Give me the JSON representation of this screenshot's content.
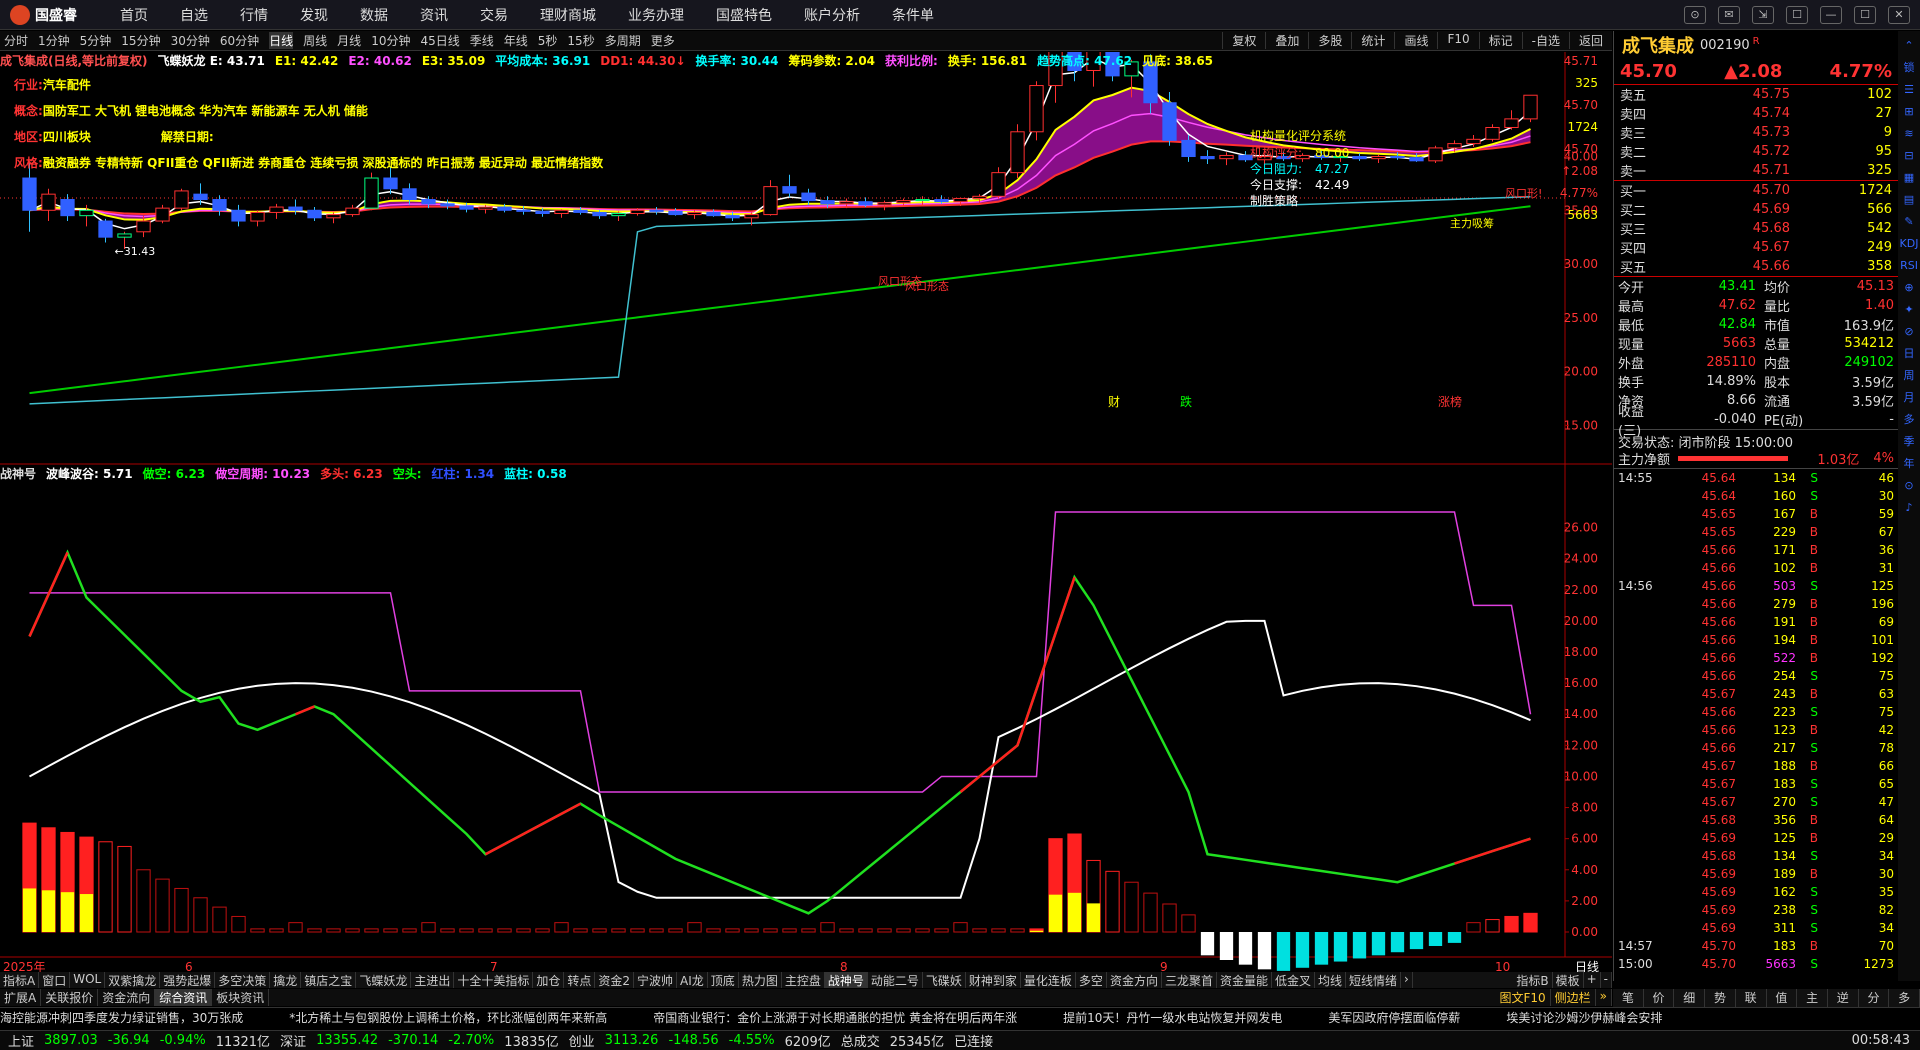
{
  "app": {
    "logo": "国盛睿",
    "menu": [
      "首页",
      "自选",
      "行情",
      "发现",
      "数据",
      "资讯",
      "交易",
      "理财商城",
      "业务办理",
      "国盛特色",
      "账户分析",
      "条件单"
    ]
  },
  "window_controls": [
    "⊙",
    "✉",
    "⇲",
    "☐",
    "—",
    "☐",
    "✕"
  ],
  "toolbar": {
    "periods": [
      "分时",
      "1分钟",
      "5分钟",
      "15分钟",
      "30分钟",
      "60分钟",
      "日线",
      "周线",
      "月线",
      "10分钟",
      "45日线",
      "季线",
      "年线",
      "5秒",
      "15秒",
      "多周期",
      "更多"
    ],
    "active": "日线",
    "right": [
      "复权",
      "叠加",
      "多股",
      "统计",
      "画线",
      "F10",
      "标记",
      "-自选",
      "返回"
    ]
  },
  "main_info": [
    {
      "t": "成飞集成(日线,等比前复权)",
      "c": "#ff5050"
    },
    {
      "t": "飞蝶妖龙 E: 43.71",
      "c": "#ffffff"
    },
    {
      "t": "E1: 42.42",
      "c": "#ffff00"
    },
    {
      "t": "E2: 40.62",
      "c": "#ff50ff"
    },
    {
      "t": "E3: 35.09",
      "c": "#ffff00"
    },
    {
      "t": "平均成本: 36.91",
      "c": "#00ffff"
    },
    {
      "t": "DD1: 44.30↓",
      "c": "#ff3030"
    },
    {
      "t": "换手率: 30.44",
      "c": "#00ffff"
    },
    {
      "t": "筹码参数: 2.04",
      "c": "#ffff00"
    },
    {
      "t": "获利比例:",
      "c": "#ff50ff"
    },
    {
      "t": "换手: 156.81",
      "c": "#ffff00"
    },
    {
      "t": "趋势高点: 47.62",
      "c": "#00ffff"
    },
    {
      "t": "见底: 38.65",
      "c": "#ffff00"
    }
  ],
  "annotations": [
    {
      "k": "行业:",
      "v": "汽车配件"
    },
    {
      "k": "概念:",
      "v": "国防军工 大飞机 锂电池概念 华为汽车 新能源车 无人机 储能"
    },
    {
      "k": "地区:",
      "v": "四川板块",
      "k2": "解禁日期:"
    },
    {
      "k": "风格:",
      "v": "融资融券 专精特新 QFII重仓 QFII新进 券商重仓 连续亏损 深股通标的 昨日振荡 最近异动 最近情绪指数"
    }
  ],
  "rating": {
    "title": "机构量化评分系统",
    "score_label": "机构评分:",
    "score": "80.00",
    "res_label": "今日阻力:",
    "res": "47.27",
    "sup_label": "今日支撑:",
    "sup": "42.49",
    "tag": "制胜策略"
  },
  "chart_labels": {
    "high": "58.77",
    "low": "←31.43",
    "f": "财",
    "d": "跌",
    "z": "涨榜",
    "wind1": "风口形态",
    "wind2": "风口形态",
    "wind3": "风口形!",
    "main_force": "主力吸筹"
  },
  "price_axis": {
    "top": [
      "45.71",
      "325",
      "45.70",
      "1724",
      "45.70",
      "↑2.08",
      "4.77%",
      "5663"
    ],
    "ticks": [
      "40.00",
      "35.00",
      "30.00",
      "25.00",
      "20.00",
      "15.00"
    ]
  },
  "sub_axis": [
    "26.00",
    "24.00",
    "22.00",
    "20.00",
    "18.00",
    "16.00",
    "14.00",
    "12.00",
    "10.00",
    "8.00",
    "6.00",
    "4.00",
    "2.00",
    "0.00"
  ],
  "x_axis": {
    "labels": [
      "2025年",
      "6",
      "7",
      "8",
      "9",
      "10"
    ],
    "right": "日线"
  },
  "sub_info": [
    {
      "t": "战神号",
      "c": "#dddddd"
    },
    {
      "t": "波峰波谷: 5.71",
      "c": "#ffffff"
    },
    {
      "t": "做空: 6.23",
      "c": "#00ff00"
    },
    {
      "t": "做空周期: 10.23",
      "c": "#ff50ff"
    },
    {
      "t": "多头: 6.23",
      "c": "#ff3030"
    },
    {
      "t": "空头:",
      "c": "#00ff00"
    },
    {
      "t": "红柱: 1.34",
      "c": "#3050ff"
    },
    {
      "t": "蓝柱: 0.58",
      "c": "#00ffff"
    }
  ],
  "chart_data": {
    "type": "candlestick",
    "x_labels": [
      "2025年",
      "6",
      "7",
      "8",
      "9",
      "10"
    ],
    "price_range": [
      14,
      46
    ],
    "series": [
      {
        "name": "E",
        "color": "#ffffff"
      },
      {
        "name": "E1",
        "color": "#ffff00"
      },
      {
        "name": "E2",
        "color": "#ff50ff"
      },
      {
        "name": "E3",
        "color": "#ffff00"
      }
    ],
    "candles": [
      [
        38,
        39.5,
        33,
        35
      ],
      [
        35,
        37,
        34,
        36.5
      ],
      [
        36,
        36.5,
        34,
        34.5
      ],
      [
        34.5,
        35.5,
        33.5,
        35
      ],
      [
        34,
        34.2,
        32,
        32.5
      ],
      [
        32.5,
        33,
        31.4,
        32.8
      ],
      [
        33,
        34.5,
        32.5,
        34
      ],
      [
        34,
        35.5,
        33.8,
        35.2
      ],
      [
        35.2,
        37,
        35,
        36.8
      ],
      [
        36.5,
        37.5,
        35.5,
        36
      ],
      [
        36,
        36.4,
        34.5,
        35
      ],
      [
        35,
        35.5,
        33.5,
        34
      ],
      [
        34,
        35,
        33.5,
        34.8
      ],
      [
        34.8,
        35.6,
        34.2,
        35.3
      ],
      [
        35.3,
        36,
        34.6,
        35
      ],
      [
        35,
        35.3,
        34,
        34.3
      ],
      [
        34.3,
        34.8,
        33.8,
        34.6
      ],
      [
        34.6,
        35.5,
        34.4,
        35.2
      ],
      [
        35.2,
        38.5,
        35,
        38
      ],
      [
        38,
        39,
        36.5,
        37
      ],
      [
        37,
        37.5,
        35.5,
        36
      ],
      [
        36,
        36.3,
        35.2,
        35.6
      ],
      [
        35.6,
        36,
        35.1,
        35.4
      ],
      [
        35.4,
        35.7,
        34.8,
        35.1
      ],
      [
        35.1,
        35.5,
        34.7,
        35.3
      ],
      [
        35.3,
        35.6,
        34.8,
        35
      ],
      [
        35,
        35.4,
        34.6,
        34.9
      ],
      [
        34.9,
        35.2,
        34.4,
        34.7
      ],
      [
        34.7,
        35.1,
        34.3,
        35
      ],
      [
        35,
        35.3,
        34.6,
        34.8
      ],
      [
        34.8,
        35,
        34.2,
        34.5
      ],
      [
        34.5,
        34.9,
        34,
        34.7
      ],
      [
        34.7,
        35.2,
        34.5,
        35
      ],
      [
        35,
        35.3,
        34.6,
        34.9
      ],
      [
        34.9,
        35.2,
        34.5,
        34.6
      ],
      [
        34.6,
        35,
        34.2,
        34.8
      ],
      [
        34.8,
        35.1,
        34.4,
        34.5
      ],
      [
        34.5,
        34.9,
        34,
        34.3
      ],
      [
        34.3,
        34.8,
        33.6,
        34.6
      ],
      [
        34.6,
        37.8,
        34.5,
        37.2
      ],
      [
        37.2,
        38.3,
        36.2,
        36.6
      ],
      [
        36.6,
        37,
        35.5,
        35.9
      ],
      [
        35.9,
        36.3,
        35.2,
        35.6
      ],
      [
        35.6,
        36.1,
        35.2,
        35.8
      ],
      [
        35.8,
        36.2,
        35.3,
        35.5
      ],
      [
        35.5,
        35.9,
        35,
        35.7
      ],
      [
        35.7,
        36.1,
        35.3,
        35.9
      ],
      [
        35.9,
        36.3,
        35.5,
        36
      ],
      [
        36,
        36.4,
        35.6,
        35.8
      ],
      [
        35.8,
        36.2,
        35.4,
        36.1
      ],
      [
        36.1,
        36.5,
        35.7,
        36.3
      ],
      [
        36.3,
        39,
        36.1,
        38.5
      ],
      [
        38.5,
        43,
        38,
        42.3
      ],
      [
        42.3,
        47,
        41.5,
        46.6
      ],
      [
        46.6,
        58.8,
        45,
        52
      ],
      [
        52,
        53,
        47,
        48
      ],
      [
        48,
        51,
        46.5,
        50.5
      ],
      [
        50.5,
        51,
        47,
        47.5
      ],
      [
        47.5,
        49,
        45.5,
        48.8
      ],
      [
        48.8,
        49.5,
        44,
        45
      ],
      [
        45,
        46,
        41,
        41.5
      ],
      [
        41.5,
        42,
        39.5,
        40
      ],
      [
        40,
        40.6,
        39.3,
        39.8
      ],
      [
        39.8,
        40.4,
        39.2,
        40.1
      ],
      [
        40.1,
        40.5,
        39.5,
        39.7
      ],
      [
        39.7,
        40.2,
        39.3,
        40
      ],
      [
        40,
        40.4,
        39.6,
        39.8
      ],
      [
        39.8,
        40.3,
        39.5,
        40.1
      ],
      [
        40.1,
        40.5,
        39.7,
        39.9
      ],
      [
        39.9,
        40.2,
        39.5,
        40
      ],
      [
        40,
        40.3,
        39.6,
        39.8
      ],
      [
        39.8,
        40.2,
        39.4,
        40
      ],
      [
        40,
        40.4,
        39.7,
        39.9
      ],
      [
        39.9,
        40.3,
        39.5,
        39.6
      ],
      [
        39.6,
        41,
        39.4,
        40.8
      ],
      [
        40.8,
        41.5,
        40.4,
        41.2
      ],
      [
        41.2,
        42,
        40.9,
        41.6
      ],
      [
        41.6,
        43,
        41.4,
        42.7
      ],
      [
        42.7,
        44.3,
        42.5,
        43.5
      ],
      [
        43.5,
        45.7,
        43.2,
        45.7
      ]
    ]
  },
  "stock": {
    "name": "成飞集成",
    "code": "002190",
    "r": "R",
    "price": "45.70",
    "change": "▲2.08",
    "pct": "4.77%"
  },
  "order_book": {
    "asks": [
      {
        "l": "卖五",
        "p": "45.75",
        "q": "102"
      },
      {
        "l": "卖四",
        "p": "45.74",
        "q": "27"
      },
      {
        "l": "卖三",
        "p": "45.73",
        "q": "9"
      },
      {
        "l": "卖二",
        "p": "45.72",
        "q": "95"
      },
      {
        "l": "卖一",
        "p": "45.71",
        "q": "325"
      }
    ],
    "bids": [
      {
        "l": "买一",
        "p": "45.70",
        "q": "1724"
      },
      {
        "l": "买二",
        "p": "45.69",
        "q": "566"
      },
      {
        "l": "买三",
        "p": "45.68",
        "q": "542"
      },
      {
        "l": "买四",
        "p": "45.67",
        "q": "249"
      },
      {
        "l": "买五",
        "p": "45.66",
        "q": "358"
      }
    ]
  },
  "stats": [
    {
      "a": "今开",
      "b": "43.41",
      "bc": "#00ff00",
      "c": "均价",
      "d": "45.13",
      "dc": "#ff3030"
    },
    {
      "a": "最高",
      "b": "47.62",
      "bc": "#ff3030",
      "c": "量比",
      "d": "1.40",
      "dc": "#ff3030"
    },
    {
      "a": "最低",
      "b": "42.84",
      "bc": "#00ff00",
      "c": "市值",
      "d": "163.9亿",
      "dc": "#dddddd"
    },
    {
      "a": "现量",
      "b": "5663",
      "bc": "#ff3030",
      "c": "总量",
      "d": "534212",
      "dc": "#ffff00"
    },
    {
      "a": "外盘",
      "b": "285110",
      "bc": "#ff3030",
      "c": "内盘",
      "d": "249102",
      "dc": "#00ff00"
    },
    {
      "a": "换手",
      "b": "14.89%",
      "bc": "#dddddd",
      "c": "股本",
      "d": "3.59亿",
      "dc": "#dddddd"
    },
    {
      "a": "净资",
      "b": "8.66",
      "bc": "#dddddd",
      "c": "流通",
      "d": "3.59亿",
      "dc": "#dddddd"
    },
    {
      "a": "收益(三)",
      "b": "-0.040",
      "bc": "#dddddd",
      "c": "PE(动)",
      "d": "-",
      "dc": "#dddddd"
    }
  ],
  "trade_status": "交易状态: 闭市阶段 15:00:00",
  "net_flow": {
    "label": "主力净额",
    "value": "1.03亿",
    "pct": "4%"
  },
  "ticks": [
    {
      "t": "14:55",
      "p": "45.64",
      "v": "134",
      "s": "S",
      "n": "46"
    },
    {
      "t": "",
      "p": "45.64",
      "v": "160",
      "s": "S",
      "n": "30"
    },
    {
      "t": "",
      "p": "45.65",
      "v": "167",
      "s": "B",
      "n": "59"
    },
    {
      "t": "",
      "p": "45.65",
      "v": "229",
      "s": "B",
      "n": "67"
    },
    {
      "t": "",
      "p": "45.66",
      "v": "171",
      "s": "B",
      "n": "36"
    },
    {
      "t": "",
      "p": "45.66",
      "v": "102",
      "s": "B",
      "n": "31"
    },
    {
      "t": "14:56",
      "p": "45.66",
      "v": "503",
      "s": "S",
      "n": "125"
    },
    {
      "t": "",
      "p": "45.66",
      "v": "279",
      "s": "B",
      "n": "196"
    },
    {
      "t": "",
      "p": "45.66",
      "v": "191",
      "s": "B",
      "n": "69"
    },
    {
      "t": "",
      "p": "45.66",
      "v": "194",
      "s": "B",
      "n": "101"
    },
    {
      "t": "",
      "p": "45.66",
      "v": "522",
      "s": "B",
      "n": "192"
    },
    {
      "t": "",
      "p": "45.66",
      "v": "254",
      "s": "S",
      "n": "75"
    },
    {
      "t": "",
      "p": "45.67",
      "v": "243",
      "s": "B",
      "n": "63"
    },
    {
      "t": "",
      "p": "45.66",
      "v": "223",
      "s": "S",
      "n": "75"
    },
    {
      "t": "",
      "p": "45.66",
      "v": "123",
      "s": "B",
      "n": "42"
    },
    {
      "t": "",
      "p": "45.66",
      "v": "217",
      "s": "S",
      "n": "78"
    },
    {
      "t": "",
      "p": "45.67",
      "v": "188",
      "s": "B",
      "n": "66"
    },
    {
      "t": "",
      "p": "45.67",
      "v": "183",
      "s": "S",
      "n": "65"
    },
    {
      "t": "",
      "p": "45.67",
      "v": "270",
      "s": "S",
      "n": "47"
    },
    {
      "t": "",
      "p": "45.68",
      "v": "356",
      "s": "B",
      "n": "64"
    },
    {
      "t": "",
      "p": "45.69",
      "v": "125",
      "s": "B",
      "n": "29"
    },
    {
      "t": "",
      "p": "45.68",
      "v": "134",
      "s": "S",
      "n": "34"
    },
    {
      "t": "",
      "p": "45.69",
      "v": "189",
      "s": "B",
      "n": "30"
    },
    {
      "t": "",
      "p": "45.69",
      "v": "162",
      "s": "S",
      "n": "35"
    },
    {
      "t": "",
      "p": "45.69",
      "v": "238",
      "s": "S",
      "n": "82"
    },
    {
      "t": "",
      "p": "45.69",
      "v": "311",
      "s": "S",
      "n": "34"
    },
    {
      "t": "14:57",
      "p": "45.70",
      "v": "183",
      "s": "B",
      "n": "70"
    },
    {
      "t": "15:00",
      "p": "45.70",
      "v": "5663",
      "s": "S",
      "n": "1273"
    }
  ],
  "side_icons": [
    "⌃",
    "锁",
    "☰",
    "⊞",
    "≋",
    "⊟",
    "▦",
    "▤",
    "✎",
    "KDJ",
    "RSI",
    "⊕",
    "✦",
    "⊘",
    "日",
    "周",
    "月",
    "多",
    "季",
    "年",
    "⊙",
    "♪"
  ],
  "indicator_tabs": [
    "指标A",
    "窗口",
    "WOL",
    "双紫擒龙",
    "强势起爆",
    "多空决策",
    "擒龙",
    "镇店之宝",
    "飞蝶妖龙",
    "主进出",
    "十全十美指标",
    "加仓",
    "转点",
    "资金2",
    "宁波帅",
    "AI龙",
    "顶底",
    "热力图",
    "主控盘",
    "战神号",
    "动能二号",
    "飞碟妖",
    "财神到家",
    "量化连板",
    "多空",
    "资金方向",
    "三龙聚首",
    "资金量能",
    "低金叉",
    "均线",
    "短线情绪",
    "›"
  ],
  "indicator_tabs_active": "战神号",
  "indicator_tabs_right": [
    "指标B",
    "模板",
    "+",
    "-"
  ],
  "ext_tabs": [
    "扩展A",
    "关联报价",
    "资金流向",
    "综合资讯",
    "板块资讯"
  ],
  "ext_tabs_right": [
    "图文F10",
    "侧边栏",
    "»"
  ],
  "rp_tabs": [
    "笔",
    "价",
    "细",
    "势",
    "联",
    "值",
    "主",
    "逆",
    "分",
    "多"
  ],
  "news": [
    "海控能源冲刺四季度发力绿证销售，30万张成",
    "*北方稀土与包钢股份上调稀土价格，环比涨幅创两年来新高",
    "帝国商业银行：金价上涨源于对长期通胀的担忧 黄金将在明后两年涨",
    "提前10天！丹竹一级水电站恢复并网发电",
    "美军因政府停摆面临停薪",
    "埃美讨论沙姆沙伊赫峰会安排"
  ],
  "status": {
    "sh_label": "上证",
    "sh": "3897.03",
    "sh_ch": "-36.94",
    "sh_pct": "-0.94%",
    "sh_amt": "11321亿",
    "sz_label": "深证",
    "sz": "13355.42",
    "sz_ch": "-370.14",
    "sz_pct": "-2.70%",
    "sz_amt": "13835亿",
    "cy_label": "创业",
    "cy": "3113.26",
    "cy_ch": "-148.56",
    "cy_pct": "-4.55%",
    "cy_amt": "6209亿",
    "total_label": "总成交",
    "total": "25345亿",
    "conn": "已连接",
    "time": "00:58:43"
  }
}
